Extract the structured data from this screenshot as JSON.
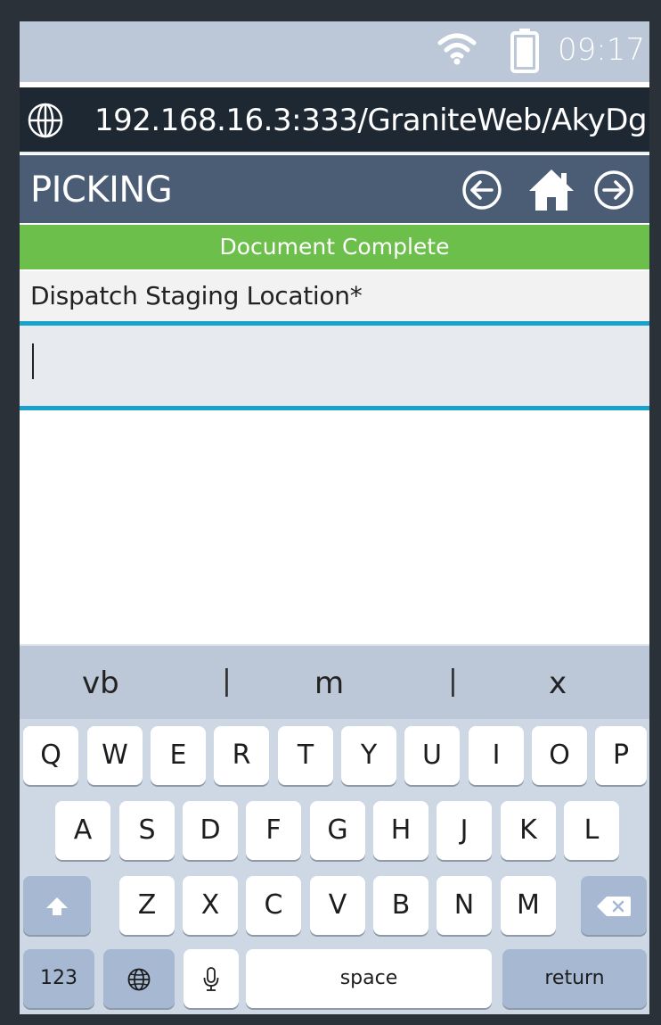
{
  "status": {
    "time": "09:17",
    "wifi_icon": "wifi-icon",
    "battery_icon": "battery-icon"
  },
  "browser": {
    "url": "192.168.16.3:333/GraniteWeb/AkyDg",
    "globe_icon": "globe-icon"
  },
  "header": {
    "title": "PICKING",
    "back_icon": "arrow-left-circle-icon",
    "home_icon": "home-icon",
    "forward_icon": "arrow-right-circle-icon"
  },
  "banner": {
    "text": "Document Complete"
  },
  "form": {
    "field_label": "Dispatch Staging Location*",
    "field_value": ""
  },
  "keyboard": {
    "suggestions": [
      "vb",
      "m",
      "x"
    ],
    "separator": "|",
    "row1": [
      "Q",
      "W",
      "E",
      "R",
      "T",
      "Y",
      "U",
      "I",
      "O",
      "P"
    ],
    "row2": [
      "A",
      "S",
      "D",
      "F",
      "G",
      "H",
      "J",
      "K",
      "L"
    ],
    "row3": [
      "Z",
      "X",
      "C",
      "V",
      "B",
      "N",
      "M"
    ],
    "numbers_label": "123",
    "space_label": "space",
    "return_label": "return",
    "shift_icon": "shift-icon",
    "backspace_icon": "backspace-icon",
    "globe_icon": "globe-icon",
    "mic_icon": "microphone-icon"
  },
  "colors": {
    "status_bg": "#bcc8d7",
    "url_bg": "#1e2833",
    "header_bg": "#4b5d74",
    "banner_bg": "#6cbf4a",
    "input_border": "#19a2cb",
    "keyboard_bg": "#ced8e5"
  }
}
